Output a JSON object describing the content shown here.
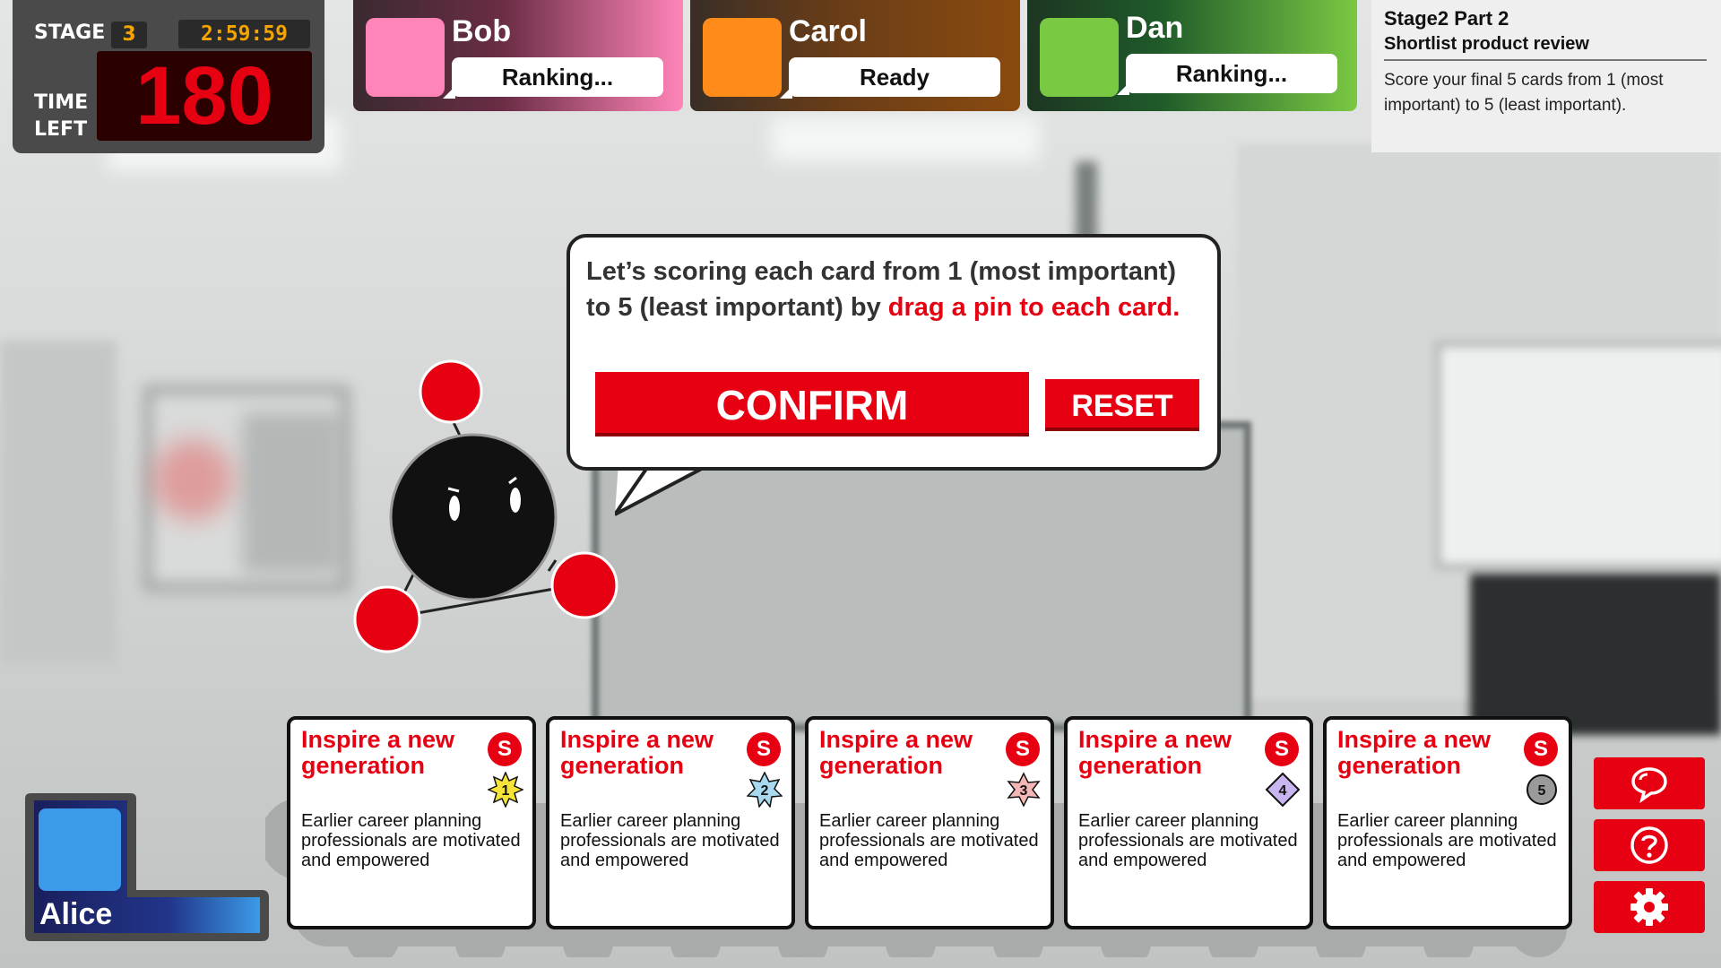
{
  "hud": {
    "stage_label": "STAGE",
    "stage_number": "3",
    "clock": "2:59:59",
    "time_left_line1": "TIME",
    "time_left_line2": "LEFT",
    "time_left_value": "180"
  },
  "players": [
    {
      "name": "Bob",
      "status": "Ranking...",
      "color": "#ff85b8"
    },
    {
      "name": "Carol",
      "status": "Ready",
      "color": "#ff8c1a"
    },
    {
      "name": "Dan",
      "status": "Ranking...",
      "color": "#7ac943"
    }
  ],
  "instruction": {
    "title": "Stage2 Part 2",
    "subtitle": "Shortlist product review",
    "body": "Score your final 5 cards from 1 (most important) to 5 (least important)."
  },
  "bubble": {
    "text_plain": "Let’s scoring each card from 1 (most important) to 5 (least important) by ",
    "text_highlight": "drag a pin to each card.",
    "confirm_label": "CONFIRM",
    "reset_label": "RESET"
  },
  "current_player": {
    "name": "Alice",
    "color": "#3b9be8"
  },
  "cards": [
    {
      "title": "Inspire a new generation",
      "badge": "S",
      "pin": "1",
      "pin_shape": "star8",
      "pin_color": "#f5e33a",
      "body": "Earlier career planning professionals are motivated and empowered"
    },
    {
      "title": "Inspire a new generation",
      "badge": "S",
      "pin": "2",
      "pin_shape": "star7",
      "pin_color": "#a9d9ee",
      "body": "Earlier career planning professionals are motivated and empowered"
    },
    {
      "title": "Inspire a new generation",
      "badge": "S",
      "pin": "3",
      "pin_shape": "star6",
      "pin_color": "#f5b6b6",
      "body": "Earlier career planning professionals are motivated and empowered"
    },
    {
      "title": "Inspire a new generation",
      "badge": "S",
      "pin": "4",
      "pin_shape": "diamond",
      "pin_color": "#c9b6f0",
      "body": "Earlier career planning professionals are motivated and empowered"
    },
    {
      "title": "Inspire a new generation",
      "badge": "S",
      "pin": "5",
      "pin_shape": "circle",
      "pin_color": "#9a9a9a",
      "body": "Earlier career planning professionals are motivated and empowered"
    }
  ],
  "tools": [
    {
      "icon": "chat-icon"
    },
    {
      "icon": "help-icon"
    },
    {
      "icon": "gear-icon"
    }
  ],
  "colors": {
    "accent_red": "#e60012",
    "timer_orange": "#f4a400"
  }
}
